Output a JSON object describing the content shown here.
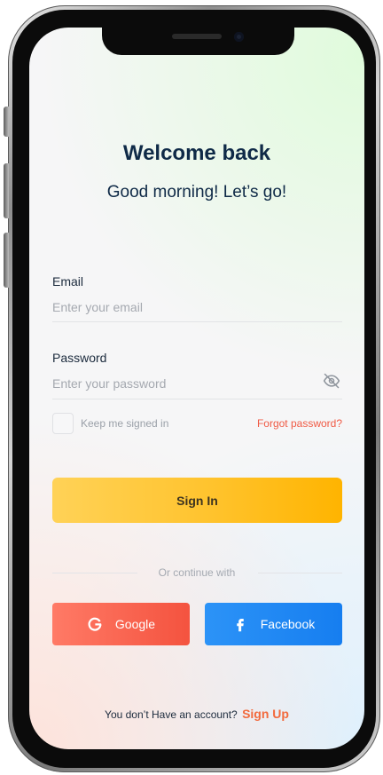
{
  "header": {
    "title": "Welcome back",
    "subtitle": "Good morning! Let’s go!"
  },
  "form": {
    "email": {
      "label": "Email",
      "placeholder": "Enter your email",
      "value": ""
    },
    "password": {
      "label": "Password",
      "placeholder": "Enter your password",
      "value": "",
      "toggle_icon": "eye-off-icon"
    },
    "remember_label": "Keep me signed in",
    "remember_checked": false,
    "forgot_label": "Forgot password?",
    "submit_label": "Sign In"
  },
  "social": {
    "divider_label": "Or continue with",
    "google_label": "Google",
    "google_icon": "google-icon",
    "facebook_label": "Facebook",
    "facebook_icon": "facebook-icon"
  },
  "footer": {
    "prompt": "You don’t Have an account?",
    "signup_label": "Sign Up"
  },
  "colors": {
    "title": "#0f2a47",
    "accent_orange": "#f26a3d",
    "primary_yellow": "#ffc32d",
    "google_red": "#f4533f",
    "facebook_blue": "#167ef0"
  }
}
